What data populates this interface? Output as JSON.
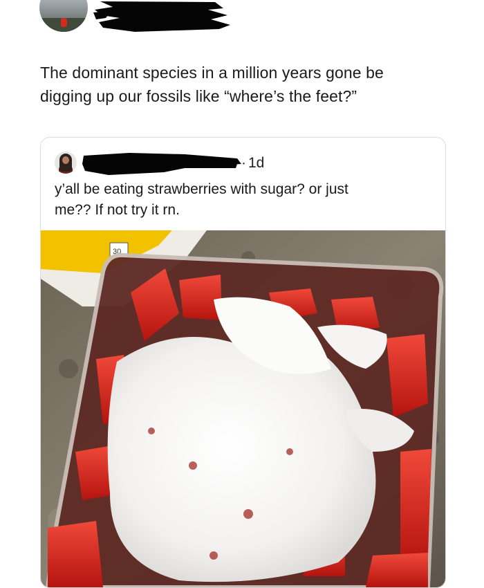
{
  "post": {
    "author_name": "",
    "text_line1": "The dominant species in a million years gone be",
    "text_line2": "digging up our fossils like “where’s the feet?”"
  },
  "quoted": {
    "author_name": "",
    "time": "1d",
    "text_line1": "y’all be eating strawberries with sugar? or just",
    "text_line2": "me?? If not try it rn.",
    "photo_label_number": "30"
  },
  "colors": {
    "strawberry": "#d8231b",
    "sugar": "#f4f3f1",
    "redaction": "#050505",
    "card_border": "#dcdcdc"
  },
  "icons": {
    "outer_avatar": "avatar-photo",
    "inner_avatar": "avatar-photo",
    "separator": "dot"
  }
}
